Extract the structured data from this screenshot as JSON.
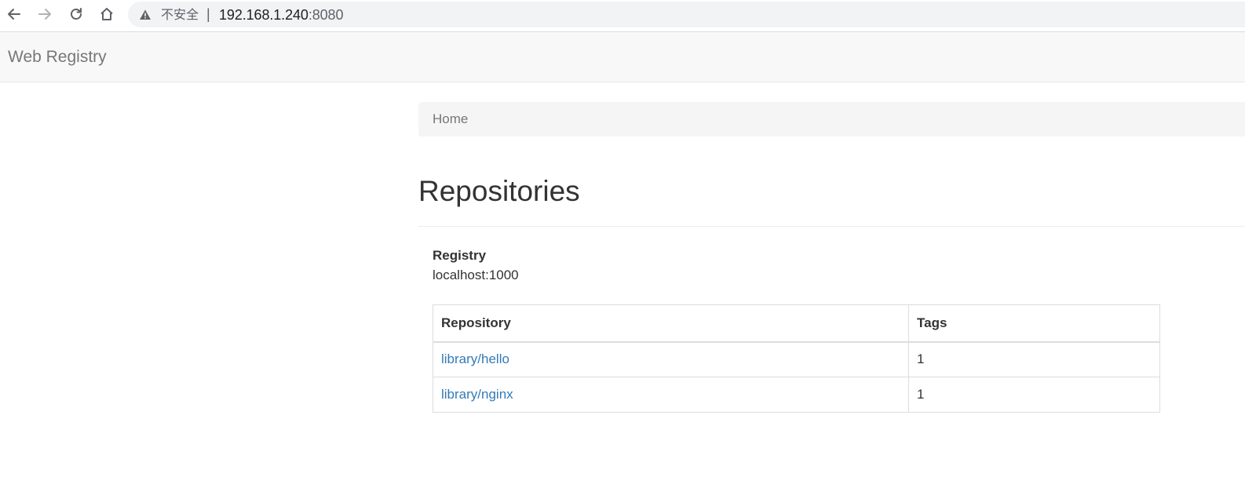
{
  "browser": {
    "security_label": "不安全",
    "separator": "|",
    "url_host": "192.168.1.240",
    "url_port": ":8080",
    "icons": [
      "back-icon",
      "forward-icon",
      "reload-icon",
      "home-icon",
      "warning-icon"
    ]
  },
  "navbar": {
    "brand": "Web Registry"
  },
  "breadcrumb": {
    "items": [
      {
        "label": "Home"
      }
    ]
  },
  "page": {
    "title": "Repositories"
  },
  "registry": {
    "label": "Registry",
    "value": "localhost:1000"
  },
  "table": {
    "headers": [
      "Repository",
      "Tags"
    ],
    "rows": [
      {
        "repository": "library/hello",
        "tags": "1"
      },
      {
        "repository": "library/nginx",
        "tags": "1"
      }
    ]
  },
  "colors": {
    "link": "#337ab7",
    "navbar_bg": "#f8f8f8",
    "breadcrumb_bg": "#f5f5f5",
    "border": "#dddddd"
  }
}
